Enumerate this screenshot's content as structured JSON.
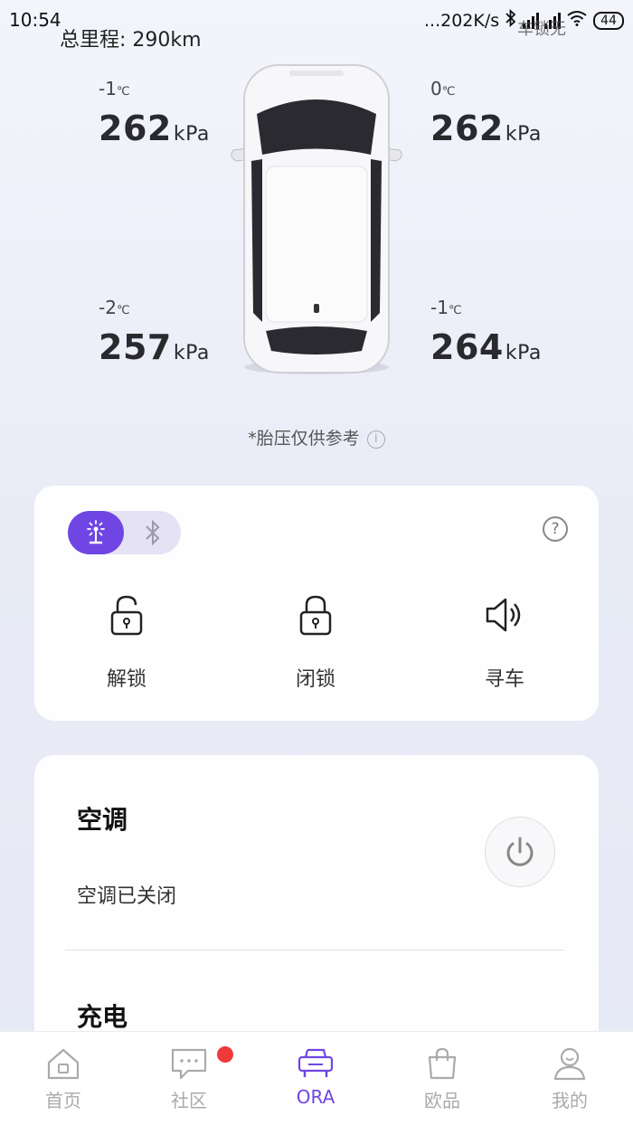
{
  "status_bar": {
    "time": "10:54",
    "net_speed": "...202K/s",
    "battery": "44"
  },
  "odometer": "总里程: 290km",
  "header_lock_text": "车锁无",
  "tires": {
    "front_left": {
      "temp": "-1",
      "pressure": "262"
    },
    "front_right": {
      "temp": "0",
      "pressure": "262"
    },
    "rear_left": {
      "temp": "-2",
      "pressure": "257"
    },
    "rear_right": {
      "temp": "-1",
      "pressure": "264"
    },
    "temp_unit": "℃",
    "pressure_unit": "kPa"
  },
  "tire_note": "*胎压仅供参考",
  "controls": {
    "unlock": "解锁",
    "lock": "闭锁",
    "find_car": "寻车"
  },
  "climate": {
    "title": "空调",
    "status": "空调已关闭"
  },
  "charging": {
    "title": "充电"
  },
  "nav": {
    "home": "首页",
    "community": "社区",
    "ora": "ORA",
    "shop": "欧品",
    "me": "我的"
  },
  "colors": {
    "accent": "#6f46e3",
    "badge": "#ee3a3a"
  }
}
